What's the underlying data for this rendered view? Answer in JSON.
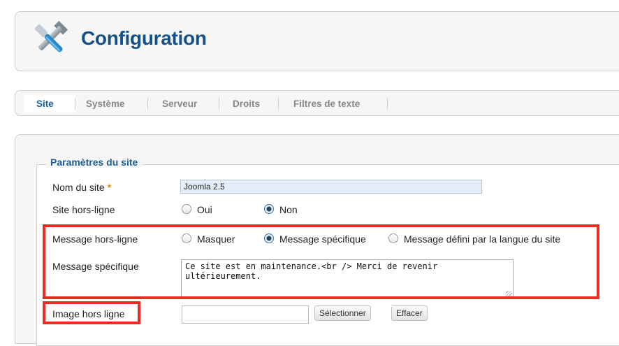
{
  "header": {
    "title": "Configuration",
    "icon": "tools-icon"
  },
  "tabs": [
    {
      "label": "Site",
      "active": true
    },
    {
      "label": "Système",
      "active": false
    },
    {
      "label": "Serveur",
      "active": false
    },
    {
      "label": "Droits",
      "active": false
    },
    {
      "label": "Filtres de texte",
      "active": false
    }
  ],
  "fieldset": {
    "legend": "Paramètres du site"
  },
  "form": {
    "site_name": {
      "label": "Nom du site",
      "required_marker": "*",
      "value": "Joomla 2.5"
    },
    "offline": {
      "label": "Site hors-ligne",
      "options": [
        {
          "label": "Oui",
          "checked": false
        },
        {
          "label": "Non",
          "checked": true
        }
      ]
    },
    "offline_message": {
      "label": "Message hors-ligne",
      "options": [
        {
          "label": "Masquer",
          "checked": false
        },
        {
          "label": "Message spécifique",
          "checked": true
        },
        {
          "label": "Message défini par la langue du site",
          "checked": false
        }
      ]
    },
    "custom_message": {
      "label": "Message spécifique",
      "value": "Ce site est en maintenance.<br /> Merci de revenir ultérieurement."
    },
    "offline_image": {
      "label": "Image hors ligne",
      "value": "",
      "select_label": "Sélectionner",
      "clear_label": "Effacer"
    }
  },
  "colors": {
    "accent": "#135289",
    "active_tab": "#1b5f9c",
    "highlight": "#ee2a24",
    "required": "#e08a1a"
  }
}
